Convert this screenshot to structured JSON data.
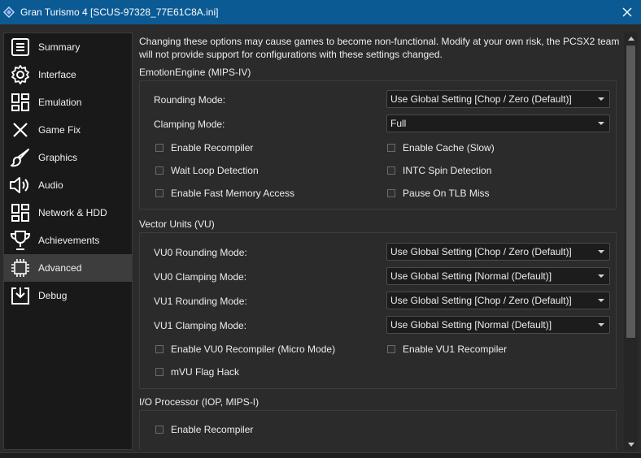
{
  "window": {
    "title": "Gran Turismo 4 [SCUS-97328_77E61C8A.ini]",
    "accent_color": "#0b5a94"
  },
  "sidebar": {
    "items": [
      {
        "label": "Summary",
        "icon": "summary-icon"
      },
      {
        "label": "Interface",
        "icon": "gear-icon"
      },
      {
        "label": "Emulation",
        "icon": "dashboard-icon"
      },
      {
        "label": "Game Fix",
        "icon": "x-icon"
      },
      {
        "label": "Graphics",
        "icon": "brush-icon"
      },
      {
        "label": "Audio",
        "icon": "speaker-icon"
      },
      {
        "label": "Network & HDD",
        "icon": "network-icon"
      },
      {
        "label": "Achievements",
        "icon": "trophy-icon"
      },
      {
        "label": "Advanced",
        "icon": "advanced-icon",
        "selected": true
      },
      {
        "label": "Debug",
        "icon": "debug-icon"
      }
    ]
  },
  "notice": "Changing these options may cause games to become non-functional. Modify at your own risk, the PCSX2 team will not provide support for configurations with these settings changed.",
  "ee": {
    "title": "EmotionEngine (MIPS-IV)",
    "rounding_label": "Rounding Mode:",
    "rounding_value": "Use Global Setting [Chop / Zero (Default)]",
    "clamping_label": "Clamping Mode:",
    "clamping_value": "Full",
    "enable_recompiler": "Enable Recompiler",
    "enable_cache": "Enable Cache (Slow)",
    "wait_loop": "Wait Loop Detection",
    "intc_spin": "INTC Spin Detection",
    "fast_memory": "Enable Fast Memory Access",
    "pause_tlb": "Pause On TLB Miss"
  },
  "vu": {
    "title": "Vector Units (VU)",
    "vu0_rounding_label": "VU0 Rounding Mode:",
    "vu0_rounding_value": "Use Global Setting [Chop / Zero (Default)]",
    "vu0_clamping_label": "VU0 Clamping Mode:",
    "vu0_clamping_value": "Use Global Setting [Normal (Default)]",
    "vu1_rounding_label": "VU1 Rounding Mode:",
    "vu1_rounding_value": "Use Global Setting [Chop / Zero (Default)]",
    "vu1_clamping_label": "VU1 Clamping Mode:",
    "vu1_clamping_value": "Use Global Setting [Normal (Default)]",
    "vu0_recompiler": "Enable VU0 Recompiler (Micro Mode)",
    "vu1_recompiler": "Enable VU1 Recompiler",
    "mvu_flag": "mVU Flag Hack"
  },
  "iop": {
    "title": "I/O Processor (IOP, MIPS-I)",
    "enable_recompiler": "Enable Recompiler"
  }
}
